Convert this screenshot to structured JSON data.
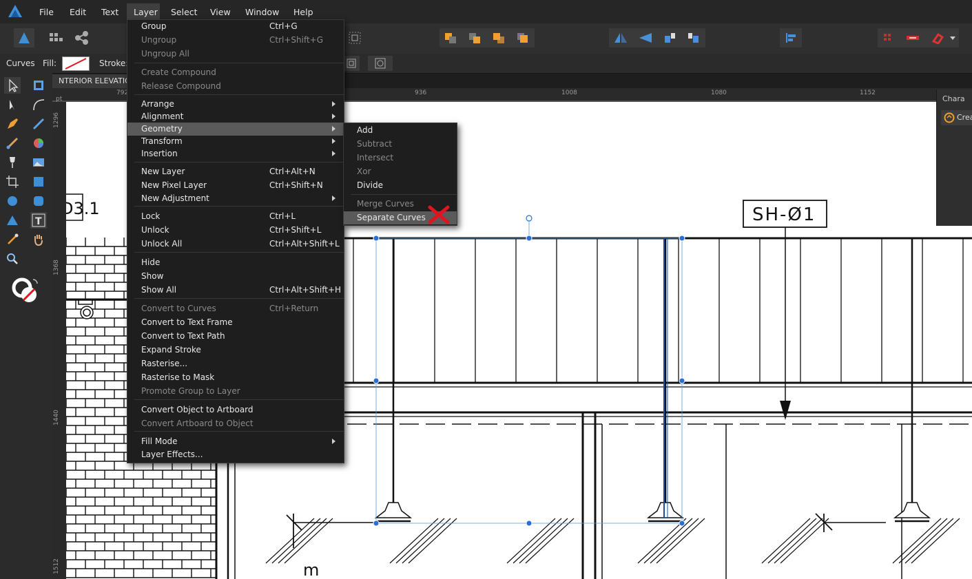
{
  "menubar": {
    "items": [
      "File",
      "Edit",
      "Text",
      "Layer",
      "Select",
      "View",
      "Window",
      "Help"
    ]
  },
  "context_bar": {
    "tool_name": "Curves",
    "fill_label": "Fill:",
    "stroke_label": "Stroke:"
  },
  "document": {
    "tab_title": "NTERIOR ELEVATION"
  },
  "ruler": {
    "top_numbers": [
      "792",
      "936",
      "1008",
      "1080",
      "1152"
    ],
    "unit": "pt",
    "left_numbers": [
      "1296",
      "1368",
      "1440",
      "1512"
    ]
  },
  "right_panel": {
    "tab": "Chara",
    "button": "Crea"
  },
  "drawing": {
    "label_left": "D3.1",
    "label_right": "SH-Ø1",
    "label_bottom": "m"
  },
  "layer_menu": {
    "items": [
      {
        "label": "Group",
        "shortcut": "Ctrl+G",
        "disabled": false
      },
      {
        "label": "Ungroup",
        "shortcut": "Ctrl+Shift+G",
        "disabled": true
      },
      {
        "label": "Ungroup All",
        "shortcut": "",
        "disabled": true
      },
      {
        "label": "Create Compound",
        "shortcut": "",
        "disabled": true
      },
      {
        "label": "Release Compound",
        "shortcut": "",
        "disabled": true
      },
      {
        "label": "Arrange",
        "shortcut": "",
        "disabled": false,
        "submenu": true
      },
      {
        "label": "Alignment",
        "shortcut": "",
        "disabled": false,
        "submenu": true
      },
      {
        "label": "Geometry",
        "shortcut": "",
        "disabled": false,
        "submenu": true,
        "highlighted": true
      },
      {
        "label": "Transform",
        "shortcut": "",
        "disabled": false,
        "submenu": true
      },
      {
        "label": "Insertion",
        "shortcut": "",
        "disabled": false,
        "submenu": true
      },
      {
        "label": "New Layer",
        "shortcut": "Ctrl+Alt+N",
        "disabled": false
      },
      {
        "label": "New Pixel Layer",
        "shortcut": "Ctrl+Shift+N",
        "disabled": false
      },
      {
        "label": "New Adjustment",
        "shortcut": "",
        "disabled": false,
        "submenu": true
      },
      {
        "label": "Lock",
        "shortcut": "Ctrl+L",
        "disabled": false
      },
      {
        "label": "Unlock",
        "shortcut": "Ctrl+Shift+L",
        "disabled": false
      },
      {
        "label": "Unlock All",
        "shortcut": "Ctrl+Alt+Shift+L",
        "disabled": false
      },
      {
        "label": "Hide",
        "shortcut": "",
        "disabled": false
      },
      {
        "label": "Show",
        "shortcut": "",
        "disabled": false
      },
      {
        "label": "Show All",
        "shortcut": "Ctrl+Alt+Shift+H",
        "disabled": false
      },
      {
        "label": "Convert to Curves",
        "shortcut": "Ctrl+Return",
        "disabled": true
      },
      {
        "label": "Convert to Text Frame",
        "shortcut": "",
        "disabled": false
      },
      {
        "label": "Convert to Text Path",
        "shortcut": "",
        "disabled": false
      },
      {
        "label": "Expand Stroke",
        "shortcut": "",
        "disabled": false
      },
      {
        "label": "Rasterise...",
        "shortcut": "",
        "disabled": false
      },
      {
        "label": "Rasterise to Mask",
        "shortcut": "",
        "disabled": false
      },
      {
        "label": "Promote Group to Layer",
        "shortcut": "",
        "disabled": true
      },
      {
        "label": "Convert Object to Artboard",
        "shortcut": "",
        "disabled": false
      },
      {
        "label": "Convert Artboard to Object",
        "shortcut": "",
        "disabled": true
      },
      {
        "label": "Fill Mode",
        "shortcut": "",
        "disabled": false,
        "submenu": true
      },
      {
        "label": "Layer Effects...",
        "shortcut": "",
        "disabled": false
      }
    ]
  },
  "geometry_submenu": {
    "items": [
      {
        "label": "Add",
        "disabled": false
      },
      {
        "label": "Subtract",
        "disabled": true
      },
      {
        "label": "Intersect",
        "disabled": true
      },
      {
        "label": "Xor",
        "disabled": true
      },
      {
        "label": "Divide",
        "disabled": false
      },
      {
        "label": "Merge Curves",
        "disabled": true
      },
      {
        "label": "Separate Curves",
        "disabled": false,
        "highlighted": true
      }
    ]
  },
  "colors": {
    "menu_bg": "#1e1e1e",
    "highlight": "#5a5a5a",
    "selection": "#2a6fd6",
    "annotation_x": "#e0141e",
    "toolbar_orange": "#f0a030",
    "toolbar_blue": "#4a90d9"
  }
}
